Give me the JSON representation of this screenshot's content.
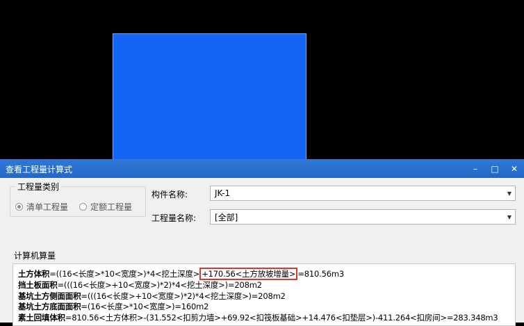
{
  "dialog": {
    "title": "查看工程量计算式",
    "window_buttons": {
      "minimize": "–",
      "maximize": "□",
      "close": "✕"
    },
    "category_group": {
      "label": "工程量类别",
      "options": [
        {
          "label": "清单工程量",
          "selected": true
        },
        {
          "label": "定额工程量",
          "selected": false
        }
      ]
    },
    "component_name": {
      "label": "构件名称:",
      "value": "JK-1"
    },
    "quantity_name": {
      "label": "工程量名称:",
      "value": "[全部]"
    },
    "calc_section_label": "计算机算量",
    "formulas": [
      {
        "name": "土方体积",
        "pre": "=((16<长度>*10<宽度>)*4<挖土深度>",
        "highlight": "+170.56<土方放坡增量>",
        "post": "=810.56m3"
      },
      {
        "name": "挡土板面积",
        "pre": "=(((16<长度>+10<宽度>)*2)*4<挖土深度>)=208m2",
        "highlight": "",
        "post": ""
      },
      {
        "name": "基坑土方侧面面积",
        "pre": "=(((16<长度>+10<宽度>)*2)*4<挖土深度>)=208m2",
        "highlight": "",
        "post": ""
      },
      {
        "name": "基坑土方底面面积",
        "pre": "=(16<长度>*10<宽度>)=160m2",
        "highlight": "",
        "post": ""
      },
      {
        "name": "素土回填体积",
        "pre": "=810.56<土方体积>-(31.552<扣剪力墙>+69.92<扣筏板基础>+14.476<扣垫层>)-411.264<扣房间>=283.348m3",
        "highlight": "",
        "post": ""
      }
    ]
  }
}
